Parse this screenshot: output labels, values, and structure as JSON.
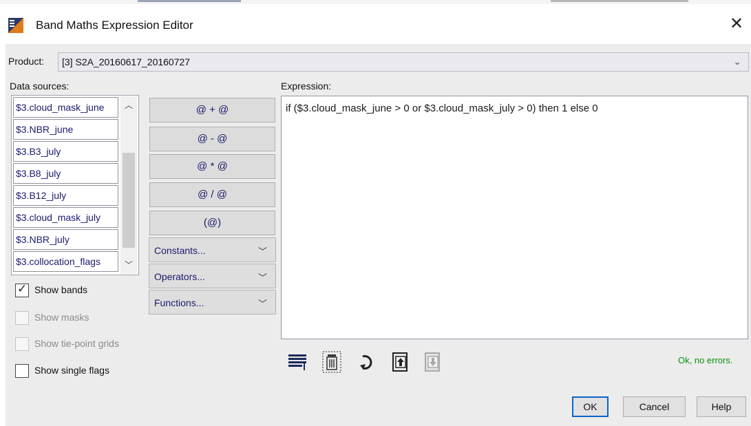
{
  "window": {
    "title": "Band Maths Expression Editor",
    "close_glyph": "✕"
  },
  "product": {
    "label": "Product:",
    "value": "[3] S2A_20160617_20160727"
  },
  "data_sources": {
    "label": "Data sources:",
    "items": [
      "$3.cloud_mask_june",
      "$3.NBR_june",
      "$3.B3_july",
      "$3.B8_july",
      "$3.B12_july",
      "$3.cloud_mask_july",
      "$3.NBR_july",
      "$3.collocation_flags"
    ]
  },
  "options": {
    "show_bands": {
      "label": "Show bands",
      "checked": true
    },
    "show_masks": {
      "label": "Show masks",
      "enabled": false
    },
    "show_tie_point_grids": {
      "label": "Show tie-point grids",
      "enabled": false
    },
    "show_single_flags": {
      "label": "Show single flags",
      "checked": false
    }
  },
  "operators": {
    "add": "@ + @",
    "subtract": "@ - @",
    "multiply": "@ * @",
    "divide": "@ / @",
    "paren": "(@)",
    "constants": "Constants...",
    "operators": "Operators...",
    "functions": "Functions..."
  },
  "expression": {
    "label": "Expression:",
    "value": "if ($3.cloud_mask_june > 0 or $3.cloud_mask_july > 0) then 1 else 0"
  },
  "toolbar_icons": [
    "edit-expression-icon",
    "delete-icon",
    "history-icon",
    "import-icon",
    "export-icon"
  ],
  "status": {
    "text": "Ok, no errors.",
    "color": "#0a8f0a"
  },
  "buttons": {
    "ok": "OK",
    "cancel": "Cancel",
    "help": "Help"
  }
}
